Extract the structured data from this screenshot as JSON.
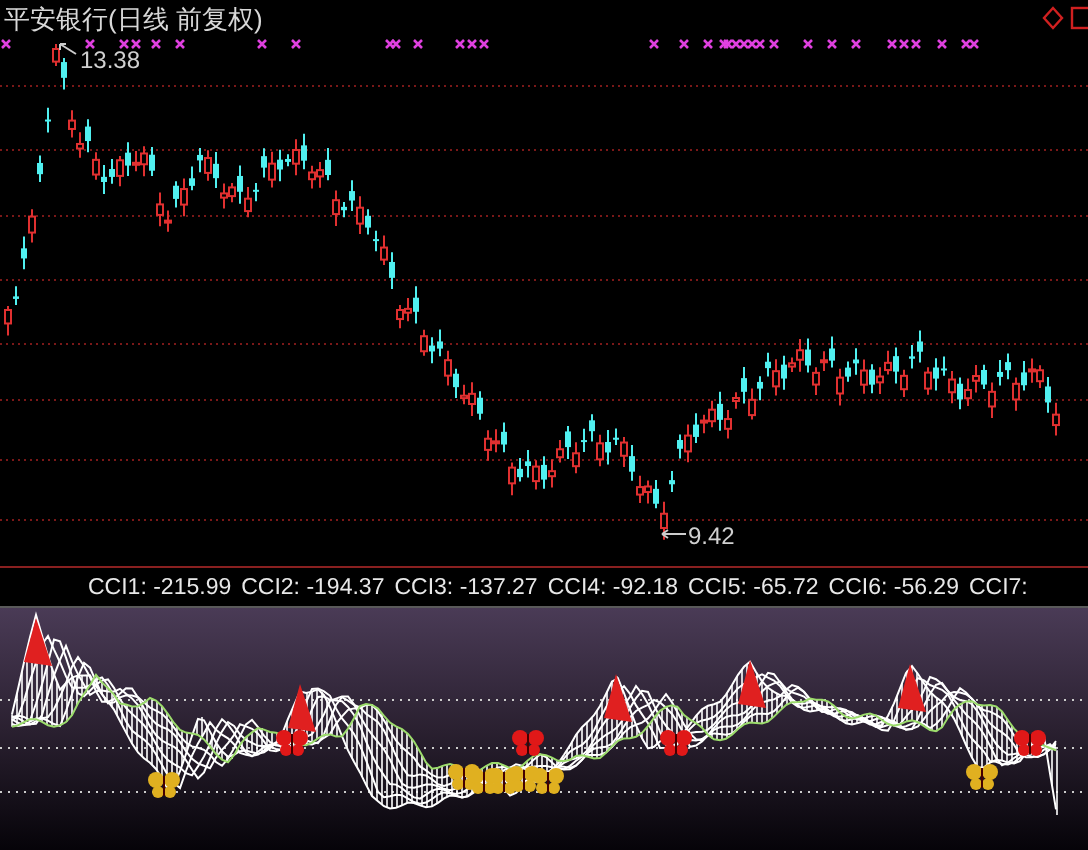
{
  "chart": {
    "title": "平安银行(日线 前复权)",
    "high_label": "13.38",
    "low_label": "9.42"
  },
  "toolbar_icons": [
    {
      "kind": "diamond"
    },
    {
      "kind": "square"
    }
  ],
  "indicator": {
    "readings": [
      {
        "label": "CCI1:",
        "value": "-215.99"
      },
      {
        "label": "CCI2:",
        "value": "-194.37"
      },
      {
        "label": "CCI3:",
        "value": "-137.27"
      },
      {
        "label": "CCI4:",
        "value": "-92.18"
      },
      {
        "label": "CCI5:",
        "value": "-65.72"
      },
      {
        "label": "CCI6:",
        "value": "-56.29"
      },
      {
        "label": "CCI7:"
      }
    ]
  }
}
